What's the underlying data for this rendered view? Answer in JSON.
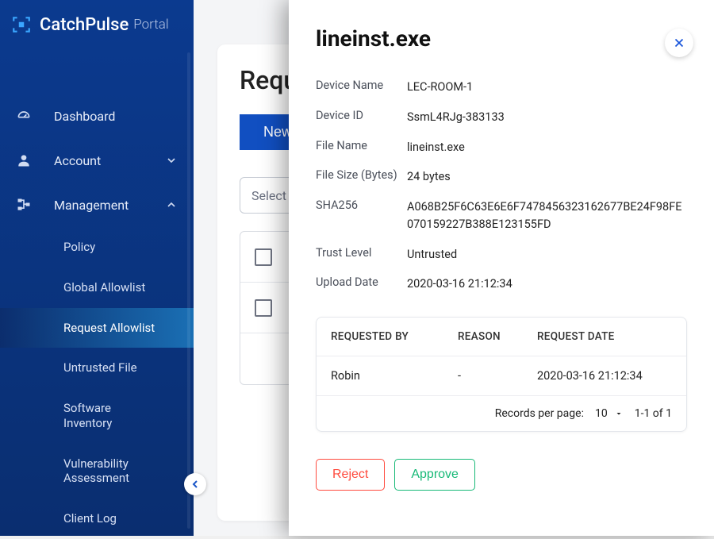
{
  "brand": {
    "name": "CatchPulse",
    "suffix": "Portal"
  },
  "sidebar": {
    "dashboard": "Dashboard",
    "account": "Account",
    "management": "Management",
    "subs": {
      "policy": "Policy",
      "global_allowlist": "Global Allowlist",
      "request_allowlist": "Request Allowlist",
      "untrusted_file": "Untrusted File",
      "software_inventory": "Software\nInventory",
      "vuln_assessment": "Vulnerability\nAssessment",
      "client_log": "Client Log"
    }
  },
  "main": {
    "title_partial": "Reque",
    "new_button": "New",
    "filter_placeholder": "Select"
  },
  "detail": {
    "title": "lineinst.exe",
    "labels": {
      "device_name": "Device Name",
      "device_id": "Device ID",
      "file_name": "File Name",
      "file_size": "File Size (Bytes)",
      "sha256": "SHA256",
      "trust_level": "Trust Level",
      "upload_date": "Upload Date"
    },
    "values": {
      "device_name": "LEC-ROOM-1",
      "device_id": "SsmL4RJg-383133",
      "file_name": "lineinst.exe",
      "file_size": "24 bytes",
      "sha256": "A068B25F6C63E6E6F7478456323162677BE24F98FE070159227B388E123155FD",
      "trust_level": "Untrusted",
      "upload_date": "2020-03-16 21:12:34"
    },
    "request_table": {
      "headers": {
        "by": "REQUESTED BY",
        "reason": "REASON",
        "date": "REQUEST DATE"
      },
      "row": {
        "by": "Robin",
        "reason": "-",
        "date": "2020-03-16 21:12:34"
      },
      "footer": {
        "rpp_label": "Records per page:",
        "rpp_value": "10",
        "range": "1-1 of 1"
      }
    },
    "actions": {
      "reject": "Reject",
      "approve": "Approve"
    }
  }
}
